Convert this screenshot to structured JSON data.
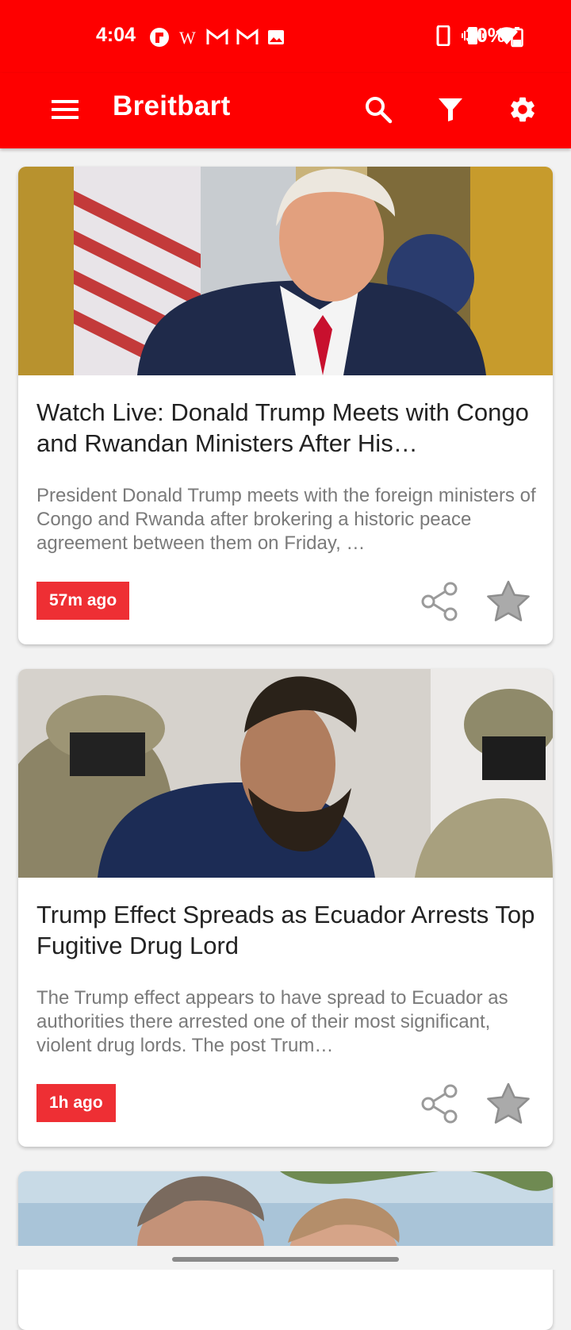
{
  "status_bar": {
    "time": "4:04",
    "battery_percent": "30%",
    "left_icons": [
      "flipboard-icon",
      "wikipedia-icon",
      "gmail-icon",
      "gmail-icon",
      "image-icon"
    ],
    "right_icons": [
      "phone-icon",
      "vibrate-icon",
      "wifi-icon",
      "battery-icon"
    ]
  },
  "app_bar": {
    "title": "Breitbart",
    "color": "#fe0000",
    "icons": [
      "menu-icon",
      "search-icon",
      "filter-icon",
      "settings-icon"
    ]
  },
  "articles": [
    {
      "title": "Watch Live: Donald Trump Meets with Congo and Rwandan Ministers After His…",
      "description": "President Donald Trump meets with the foreign ministers of Congo and Rwanda after brokering a historic peace agreement between them on Friday, …",
      "time": "57m ago",
      "image_icon": "article-photo"
    },
    {
      "title": "Trump Effect Spreads as Ecuador Arrests Top Fugitive Drug Lord",
      "description": "The Trump effect appears to have spread to Ecuador as authorities there arrested one of their most significant, violent drug lords. The post Trum…",
      "time": "1h ago",
      "image_icon": "article-photo"
    },
    {
      "title": "",
      "description": "",
      "time": "",
      "image_icon": "article-photo"
    }
  ],
  "colors": {
    "badge": "#ee2f34",
    "title_text": "#222222",
    "desc_text": "#7a7a7a"
  }
}
